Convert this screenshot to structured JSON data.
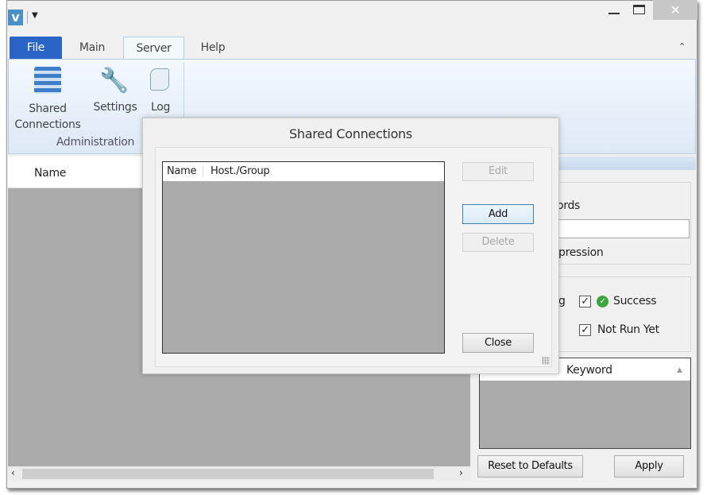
{
  "title_bar": {
    "app_icon": "v-logo",
    "quick_access": "customize-quick-access-icon"
  },
  "ribbon": {
    "tabs": [
      {
        "label": "File"
      },
      {
        "label": "Main"
      },
      {
        "label": "Server"
      },
      {
        "label": "Help"
      }
    ],
    "active_tab": "Server",
    "group_label": "Administration",
    "buttons": [
      {
        "label": "Shared\nConnections",
        "icon": "server-icon"
      },
      {
        "label": "Settings",
        "icon": "wrench-icon"
      },
      {
        "label": "Log",
        "icon": "scroll-icon"
      }
    ]
  },
  "main_list": {
    "column": "Name"
  },
  "filter_panel": {
    "keywords_fragment": "ords",
    "keyword_value": "",
    "regex_fragment": "pression",
    "status_fragment": "g",
    "checkboxes": [
      {
        "label": "Success",
        "checked": true
      },
      {
        "label": "Not Run Yet",
        "checked": true
      }
    ],
    "list_column": "Keyword",
    "reset_label": "Reset to Defaults",
    "apply_label": "Apply"
  },
  "dialog": {
    "title": "Shared Connections",
    "columns": [
      "Name",
      "Host./Group"
    ],
    "edit_label": "Edit",
    "add_label": "Add",
    "delete_label": "Delete",
    "close_label": "Close"
  },
  "colors": {
    "file_tab": "#2a64c5",
    "ribbon": "#dde9f6",
    "list_bg": "#ababab"
  }
}
